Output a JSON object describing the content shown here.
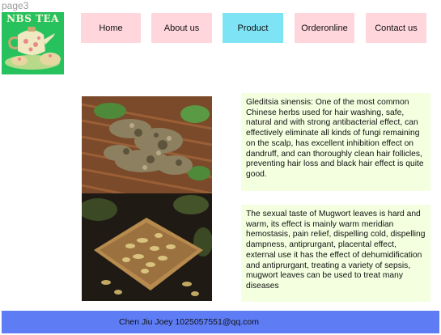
{
  "frame_label": "page3",
  "logo": {
    "text": "NBS TEA"
  },
  "nav": {
    "items": [
      {
        "label": "Home",
        "active": false
      },
      {
        "label": "About us",
        "active": false
      },
      {
        "label": "Product",
        "active": true
      },
      {
        "label": "Orderonline",
        "active": false
      },
      {
        "label": "Contact us",
        "active": false
      }
    ]
  },
  "products": [
    {
      "image": "gleditsia-herb-photo",
      "description": "Gleditsia sinensis: One of the most common Chinese herbs used for hair washing, safe, natural and with strong antibacterial effect, can effectively eliminate all kinds of fungi remaining on the scalp, has excellent inhibition effect on dandruff, and can thoroughly clean hair follicles, preventing hair loss and black hair effect is quite good."
    },
    {
      "image": "mugwort-herb-photo",
      "description": "The sexual taste of Mugwort leaves is hard and warm, its effect is mainly warm meridian hemostasis, pain relief, dispelling cold, dispelling dampness, antiprurgant, placental effect, external use it has the effect of dehumidification and antiprurgant, treating a variety of sepsis, mugwort leaves can be used to treat many diseases"
    }
  ],
  "footer": {
    "text": "Chen Jiu Joey 1025057551@qq.com"
  },
  "colors": {
    "nav_default": "#ffd6dc",
    "nav_active": "#7ee3f5",
    "desc_bg": "#f4ffe0",
    "footer_bg": "#5e7df5",
    "logo_bg": "#27c25e"
  }
}
